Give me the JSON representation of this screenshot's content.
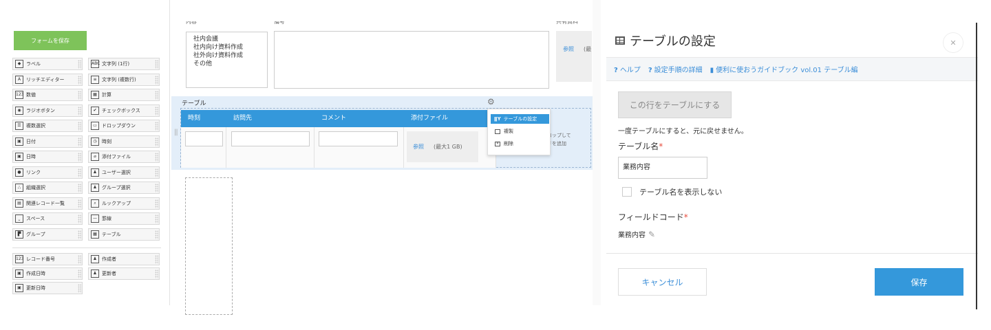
{
  "left_panel": {
    "save_form_label": "フォームを保存",
    "items": [
      {
        "label": "ラベル",
        "icon": "◆"
      },
      {
        "label": "文字列 (1行)",
        "icon": "ABC"
      },
      {
        "label": "リッチエディター",
        "icon": "A"
      },
      {
        "label": "文字列 (複数行)",
        "icon": "≡"
      },
      {
        "label": "数値",
        "icon": "123"
      },
      {
        "label": "計算",
        "icon": "▦"
      },
      {
        "label": "ラジオボタン",
        "icon": "◉"
      },
      {
        "label": "チェックボックス",
        "icon": "✔"
      },
      {
        "label": "複数選択",
        "icon": "☰"
      },
      {
        "label": "ドロップダウン",
        "icon": "▭"
      },
      {
        "label": "日付",
        "icon": "▣"
      },
      {
        "label": "時刻",
        "icon": "◷"
      },
      {
        "label": "日時",
        "icon": "▣"
      },
      {
        "label": "添付ファイル",
        "icon": "⌀"
      },
      {
        "label": "リンク",
        "icon": "●"
      },
      {
        "label": "ユーザー選択",
        "icon": "♟"
      },
      {
        "label": "組織選択",
        "icon": "⛬"
      },
      {
        "label": "グループ選択",
        "icon": "♟"
      },
      {
        "label": "関連レコード一覧",
        "icon": "▤"
      },
      {
        "label": "ルックアップ",
        "icon": "⌕"
      },
      {
        "label": "スペース",
        "icon": "⎵"
      },
      {
        "label": "罫線",
        "icon": "—"
      },
      {
        "label": "グループ",
        "icon": "▛"
      },
      {
        "label": "テーブル",
        "icon": "▦"
      }
    ],
    "system_items": [
      {
        "label": "レコード番号",
        "icon": "123"
      },
      {
        "label": "作成者",
        "icon": "♟"
      },
      {
        "label": "作成日時",
        "icon": "▣"
      },
      {
        "label": "更新者",
        "icon": "♟"
      },
      {
        "label": "更新日時",
        "icon": "▣"
      }
    ]
  },
  "form": {
    "field_label_1": "内容",
    "field_label_2": "備考",
    "field_label_3": "共有資料",
    "business_items": [
      "社内会議",
      "社内向け資料作成",
      "社外向け資料作成",
      "その他"
    ],
    "attach_top": {
      "browse": "参照",
      "note": "(最"
    },
    "table_label": "テーブル",
    "columns": [
      "時刻",
      "訪問先",
      "コメント",
      "添付ファイル"
    ],
    "attach_cell": {
      "browse": "参照",
      "max": "(最大1 GB)"
    },
    "drop_hint": [
      "ロップして",
      "ドを追加"
    ],
    "context_menu": {
      "table_settings": "テーブルの設定",
      "duplicate": "複製",
      "delete": "削除"
    }
  },
  "dialog": {
    "title": "テーブルの設定",
    "help_links": [
      "ヘルプ",
      "設定手順の詳細",
      "便利に使おうガイドブック vol.01 テーブル編"
    ],
    "make_table_button": "この行をテーブルにする",
    "warning": "一度テーブルにすると、元に戻せません。",
    "table_name_label": "テーブル名",
    "required_mark": "*",
    "table_name_value": "業務内容",
    "hide_name_label": "テーブル名を表示しない",
    "field_code_label": "フィールドコード",
    "field_code_value": "業務内容",
    "cancel_label": "キャンセル",
    "save_label": "保存"
  }
}
